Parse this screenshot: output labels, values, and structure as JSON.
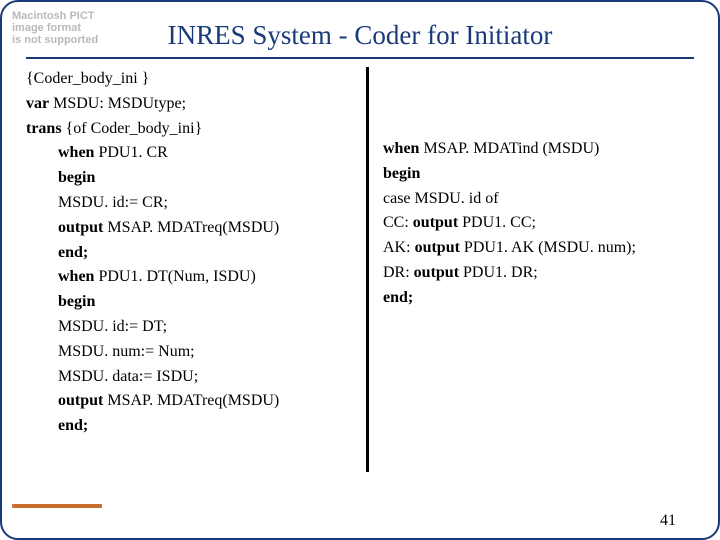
{
  "corner_note": "Macintosh PICT\nimage format\nis not supported",
  "title": "INRES System - Coder for Initiator",
  "page_number": "41",
  "left": {
    "l1a": "{Coder_body_ini }",
    "l2a": "var",
    "l2b": " MSDU: MSDUtype;",
    "l3a": "trans",
    "l3b": " {of Coder_body_ini}",
    "l4a": "when",
    "l4b": " PDU1. CR",
    "l5a": "begin",
    "l6a": "MSDU. id:= CR;",
    "l7a": "output",
    "l7b": " MSAP. MDATreq(MSDU)",
    "l8a": "end;",
    "l9a": "when",
    "l9b": " PDU1. DT(Num, ISDU)",
    "l10a": "begin",
    "l11a": "MSDU. id:= DT;",
    "l12a": "MSDU. num:= Num;",
    "l13a": "MSDU. data:= ISDU;",
    "l14a": "output",
    "l14b": " MSAP. MDATreq(MSDU)",
    "l15a": "end;"
  },
  "right": {
    "l1a": "when",
    "l1b": " MSAP. MDATind (MSDU)",
    "l2a": "begin",
    "l3a": "case MSDU. id of",
    "l4a": "CC: ",
    "l4b": "output",
    "l4c": " PDU1. CC;",
    "l5a": "AK: ",
    "l5b": "output",
    "l5c": " PDU1. AK (MSDU. num);",
    "l6a": "DR: ",
    "l6b": "output",
    "l6c": " PDU1. DR;",
    "l7a": "end;"
  }
}
